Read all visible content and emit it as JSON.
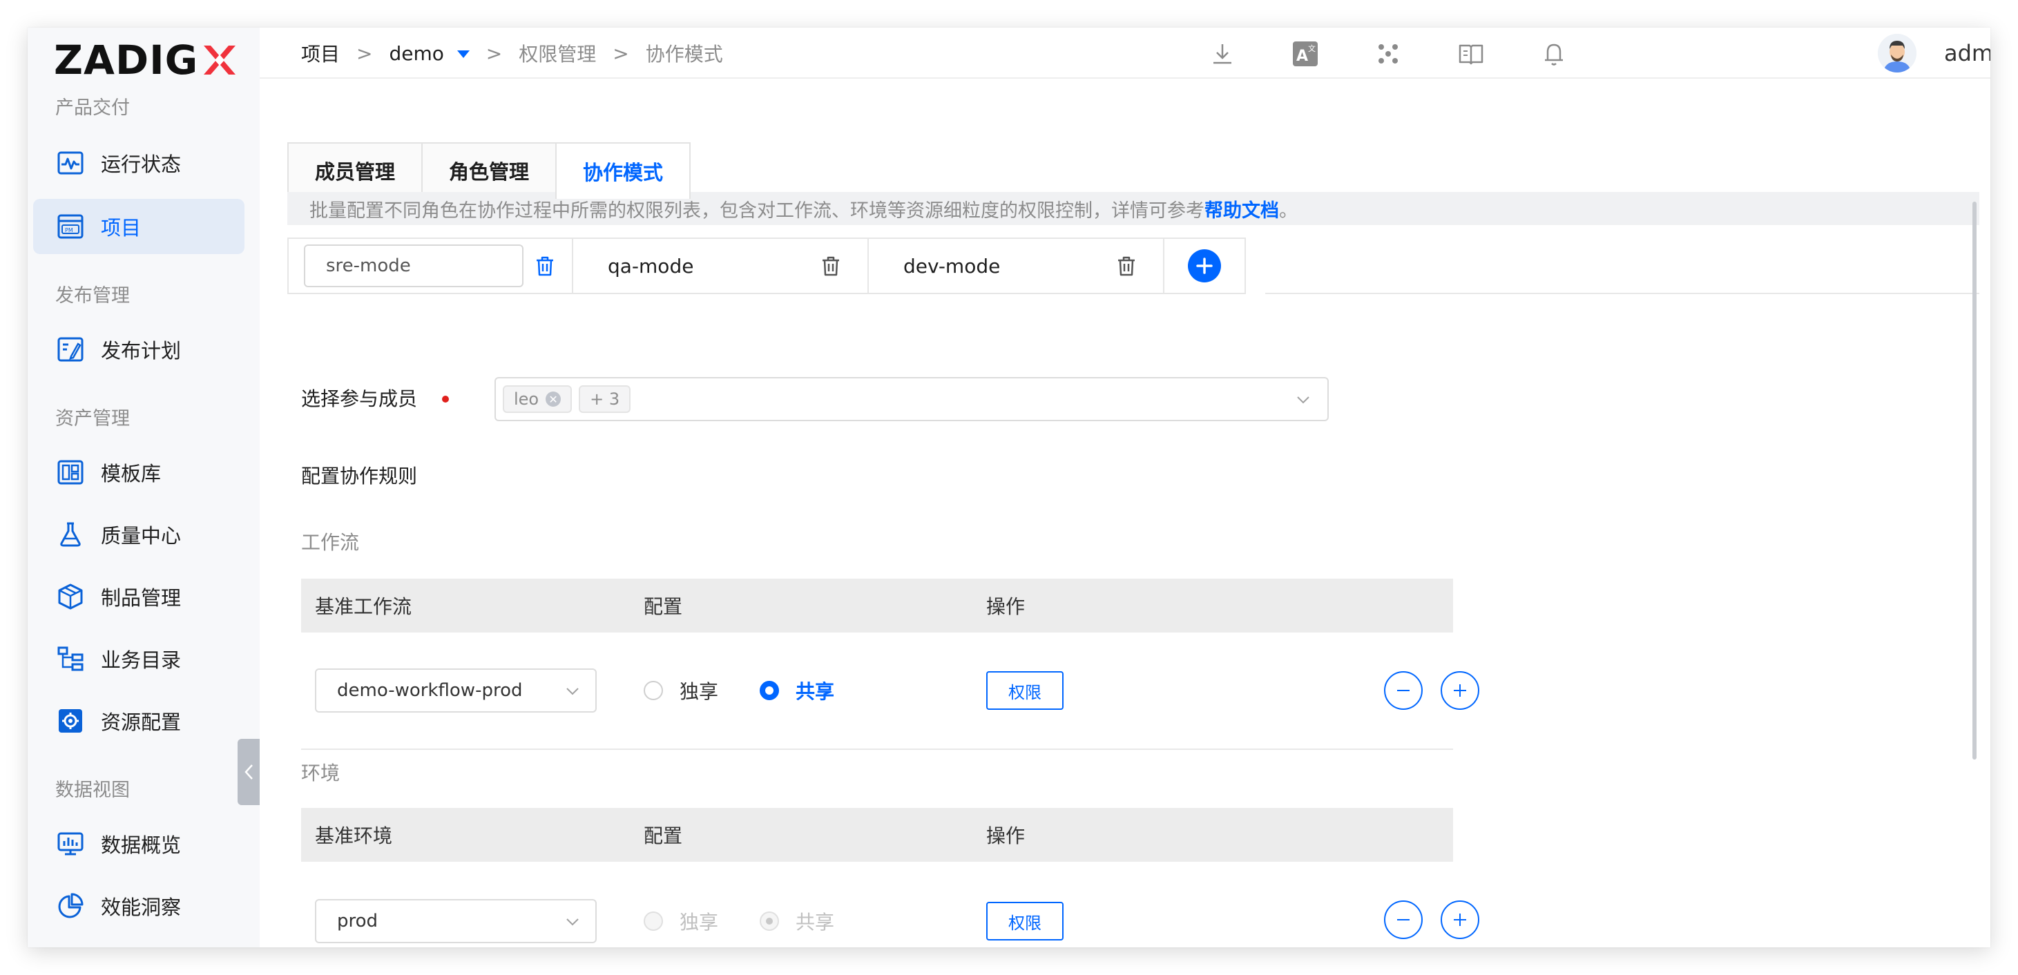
{
  "brand": {
    "logo_text": "ZADIG",
    "logo_accent": "X"
  },
  "sidebar": {
    "sections": [
      {
        "title": "产品交付"
      },
      {
        "title": "发布管理"
      },
      {
        "title": "资产管理"
      },
      {
        "title": "数据视图"
      }
    ],
    "items": [
      {
        "label": "运行状态",
        "icon": "activity-monitor-icon"
      },
      {
        "label": "项目",
        "icon": "project-board-icon",
        "active": true
      },
      {
        "label": "发布计划",
        "icon": "release-plan-icon"
      },
      {
        "label": "模板库",
        "icon": "template-library-icon"
      },
      {
        "label": "质量中心",
        "icon": "flask-icon"
      },
      {
        "label": "制品管理",
        "icon": "package-box-icon"
      },
      {
        "label": "业务目录",
        "icon": "hierarchy-tree-icon"
      },
      {
        "label": "资源配置",
        "icon": "gear-box-icon"
      },
      {
        "label": "数据概览",
        "icon": "monitor-chart-icon"
      },
      {
        "label": "效能洞察",
        "icon": "pie-chart-icon"
      }
    ]
  },
  "breadcrumb": {
    "items": [
      "项目",
      "demo",
      "权限管理",
      "协作模式"
    ],
    "separator": ">"
  },
  "header": {
    "username": "admin(admin)"
  },
  "tabs": [
    {
      "label": "成员管理"
    },
    {
      "label": "角色管理"
    },
    {
      "label": "协作模式",
      "active": true
    }
  ],
  "info": {
    "text": "批量配置不同角色在协作过程中所需的权限列表，包含对工作流、环境等资源细粒度的权限控制，详情可参考 ",
    "link": "帮助文档",
    "suffix": "。"
  },
  "modes": [
    {
      "name": "sre-mode",
      "editing": true
    },
    {
      "name": "qa-mode"
    },
    {
      "name": "dev-mode"
    }
  ],
  "form": {
    "members_label": "选择参与成员",
    "selected_member": "leo",
    "more_count": "+ 3",
    "rules_heading": "配置协作规则"
  },
  "workflow": {
    "title": "工作流",
    "headers": [
      "基准工作流",
      "配置",
      "操作"
    ],
    "base": "demo-workflow-prod",
    "option_exclusive": "独享",
    "option_shared": "共享",
    "selected": "shared",
    "permission_label": "权限"
  },
  "environment": {
    "title": "环境",
    "headers": [
      "基准环境",
      "配置",
      "操作"
    ],
    "base": "prod",
    "option_exclusive": "独享",
    "option_shared": "共享",
    "selected": "shared",
    "disabled": true,
    "permission_label": "权限"
  },
  "colors": {
    "accent": "#0066ff",
    "required": "#e0201c",
    "logo_x_red": "#f0323c",
    "active_bg": "#e3ebf7"
  }
}
